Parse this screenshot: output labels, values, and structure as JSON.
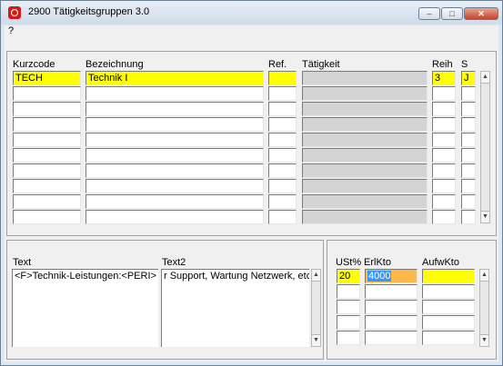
{
  "window": {
    "title": "2900 Tätigkeitsgruppen 3.0",
    "minimize_glyph": "‒",
    "maximize_glyph": "□",
    "close_glyph": "✕"
  },
  "menu": {
    "help": "?"
  },
  "grid": {
    "columns": {
      "kurzcode": "Kurzcode",
      "bezeichnung": "Bezeichnung",
      "ref": "Ref.",
      "taetigkeit": "Tätigkeit",
      "reih": "Reih",
      "s": "S"
    },
    "rows": [
      {
        "kurzcode": "TECH",
        "bezeichnung": "Technik I",
        "ref": "",
        "taetigkeit": "",
        "reih": "3",
        "s": "J"
      },
      {
        "kurzcode": "",
        "bezeichnung": "",
        "ref": "",
        "taetigkeit": "",
        "reih": "",
        "s": ""
      },
      {
        "kurzcode": "",
        "bezeichnung": "",
        "ref": "",
        "taetigkeit": "",
        "reih": "",
        "s": ""
      },
      {
        "kurzcode": "",
        "bezeichnung": "",
        "ref": "",
        "taetigkeit": "",
        "reih": "",
        "s": ""
      },
      {
        "kurzcode": "",
        "bezeichnung": "",
        "ref": "",
        "taetigkeit": "",
        "reih": "",
        "s": ""
      },
      {
        "kurzcode": "",
        "bezeichnung": "",
        "ref": "",
        "taetigkeit": "",
        "reih": "",
        "s": ""
      },
      {
        "kurzcode": "",
        "bezeichnung": "",
        "ref": "",
        "taetigkeit": "",
        "reih": "",
        "s": ""
      },
      {
        "kurzcode": "",
        "bezeichnung": "",
        "ref": "",
        "taetigkeit": "",
        "reih": "",
        "s": ""
      },
      {
        "kurzcode": "",
        "bezeichnung": "",
        "ref": "",
        "taetigkeit": "",
        "reih": "",
        "s": ""
      },
      {
        "kurzcode": "",
        "bezeichnung": "",
        "ref": "",
        "taetigkeit": "",
        "reih": "",
        "s": ""
      }
    ]
  },
  "texts": {
    "text_label": "Text",
    "text_value": "<F>Technik-Leistungen:<PERI>",
    "text2_label": "Text2",
    "text2_value": "r Support, Wartung Netzwerk, etc."
  },
  "accounts": {
    "columns": {
      "ust": "USt%",
      "erlkto": "ErlKto",
      "aufwkto": "AufwKto"
    },
    "rows": [
      {
        "ust": "20",
        "erlkto": "4000",
        "aufwkto": ""
      },
      {
        "ust": "",
        "erlkto": "",
        "aufwkto": ""
      },
      {
        "ust": "",
        "erlkto": "",
        "aufwkto": ""
      },
      {
        "ust": "",
        "erlkto": "",
        "aufwkto": ""
      },
      {
        "ust": "",
        "erlkto": "",
        "aufwkto": ""
      }
    ]
  },
  "scroll": {
    "up_glyph": "▲",
    "down_glyph": "▼"
  },
  "colors": {
    "required": "#ffff00",
    "readonly": "#d4d4d4",
    "highlight": "#ffb94b"
  }
}
